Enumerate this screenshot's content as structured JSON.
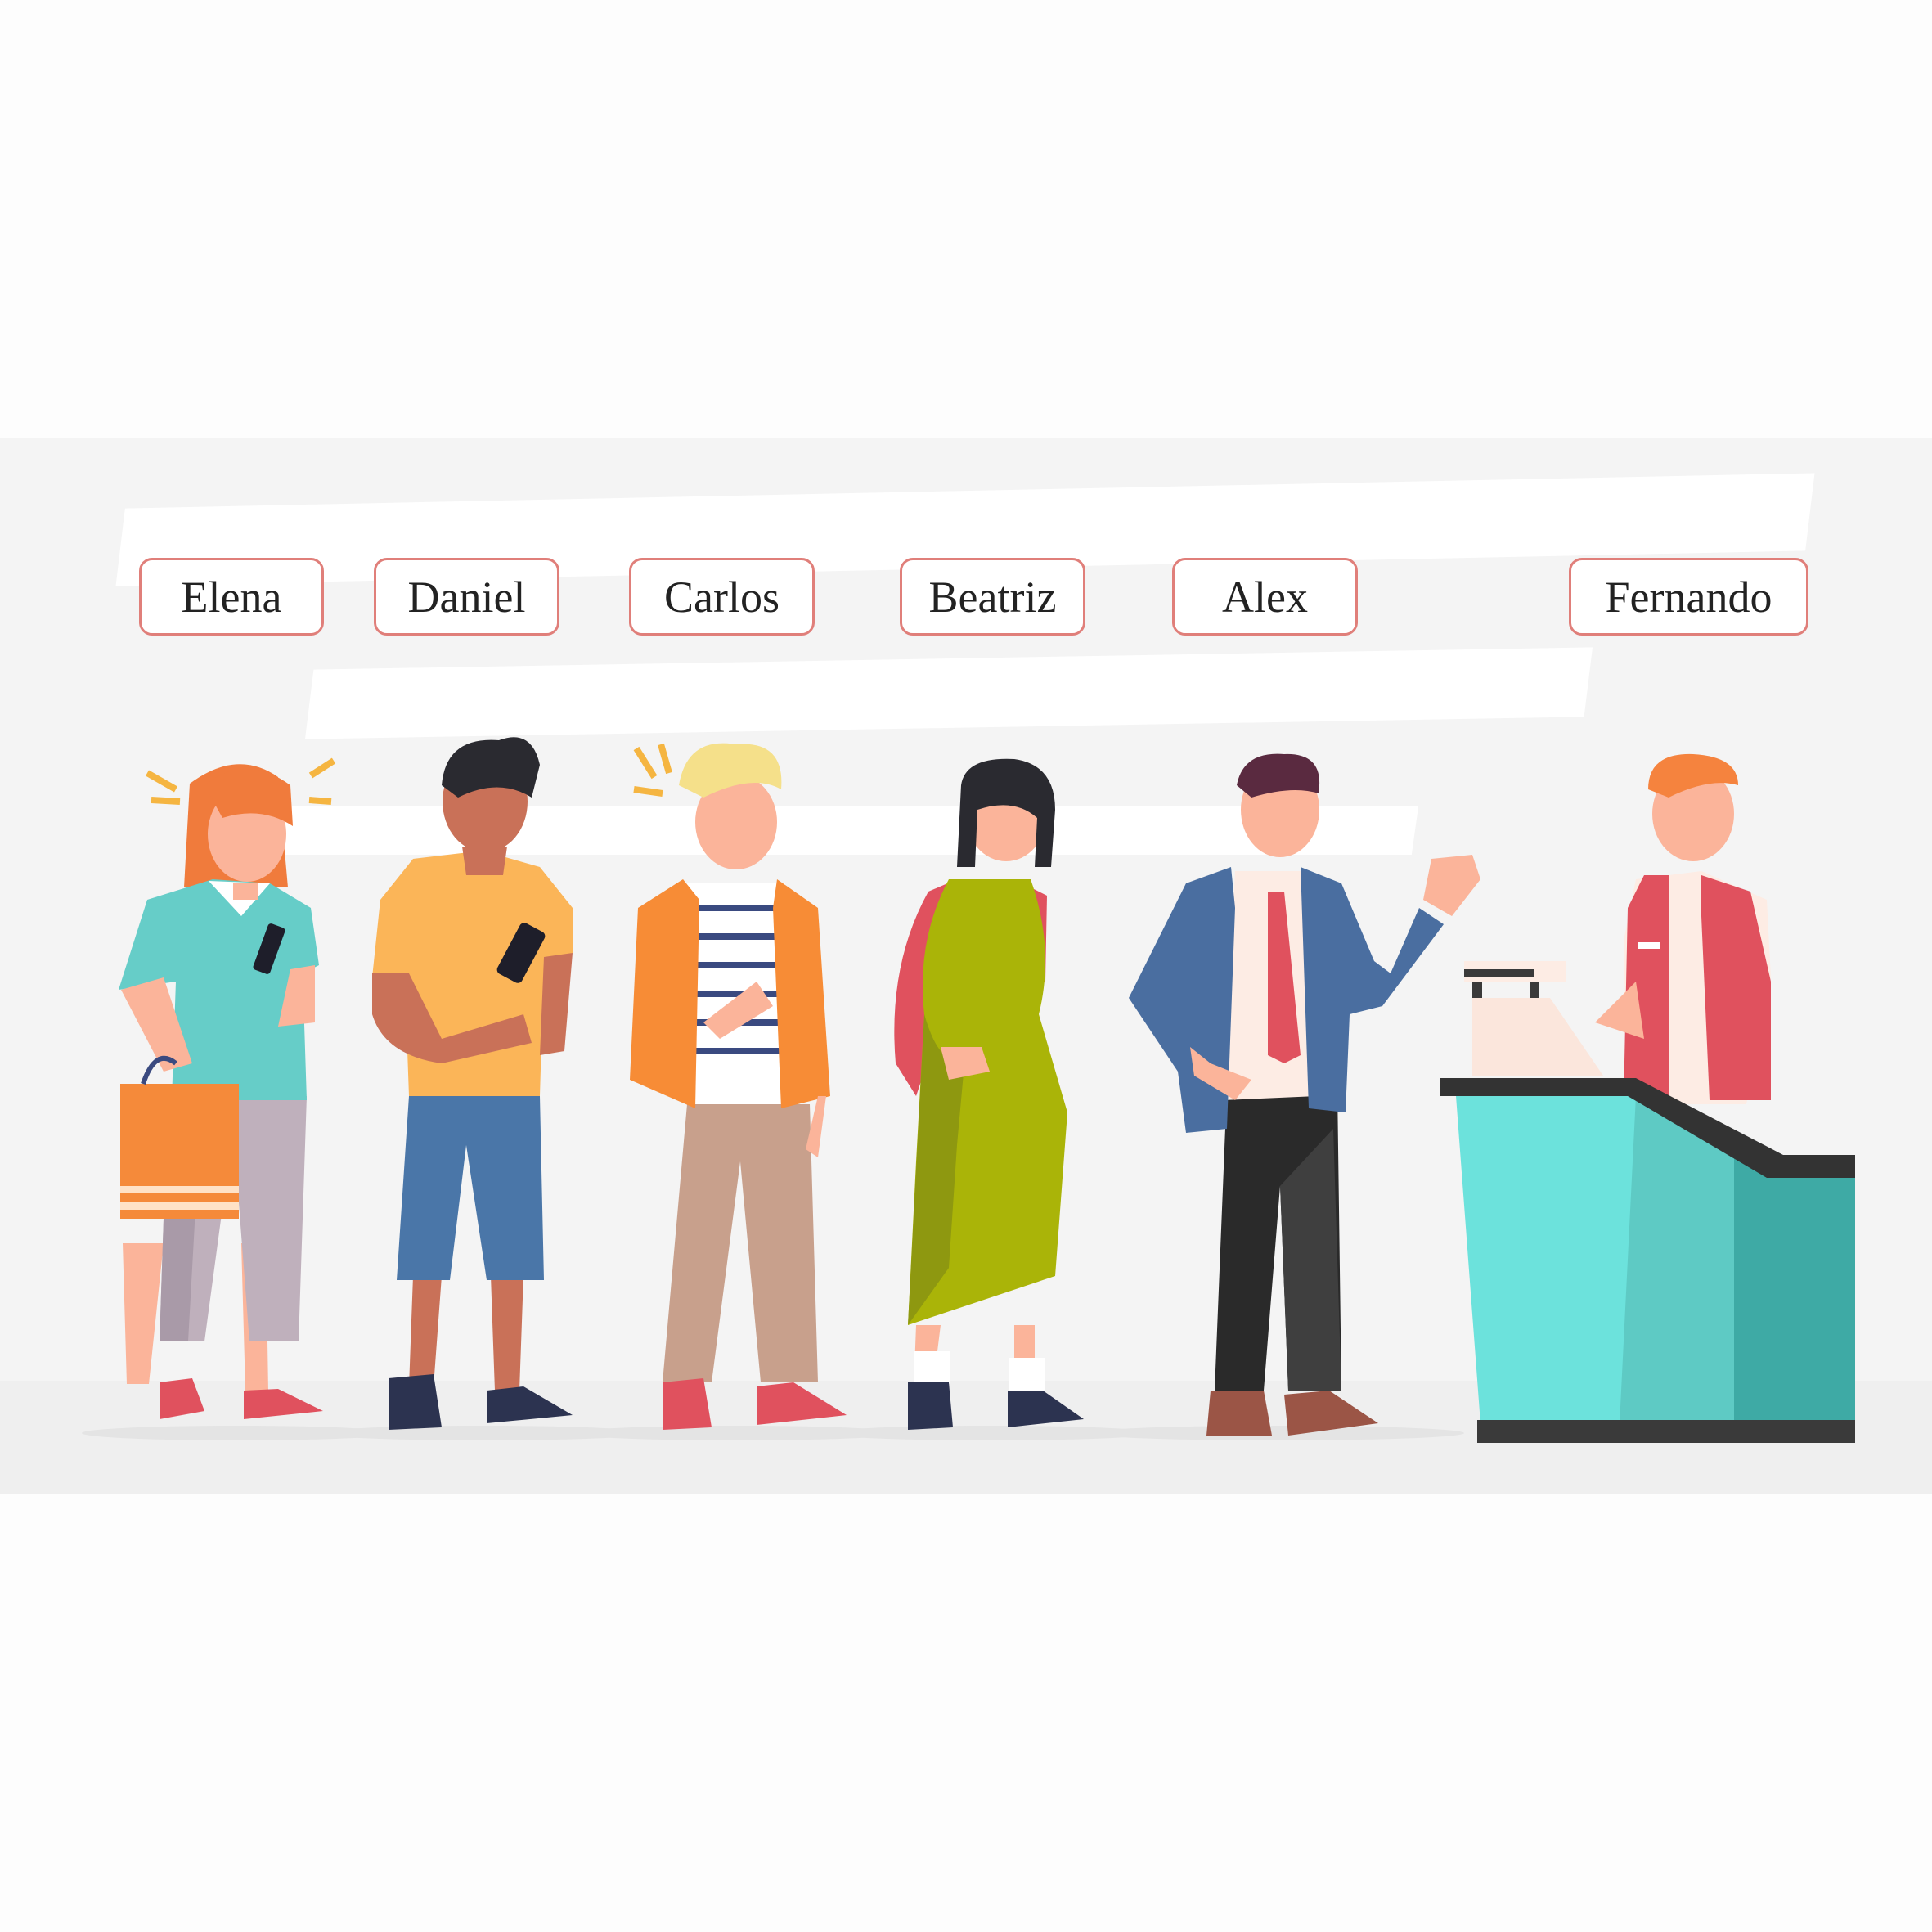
{
  "labels": {
    "elena": "Elena",
    "daniel": "Daniel",
    "carlos": "Carlos",
    "beatriz": "Beatriz",
    "alex": "Alex",
    "fernando": "Fernando"
  },
  "colors": {
    "tag_border": "#e07f7a",
    "counter_teal": "#6ce2dc",
    "counter_top": "#333333",
    "background_band": "#f4f4f4"
  }
}
